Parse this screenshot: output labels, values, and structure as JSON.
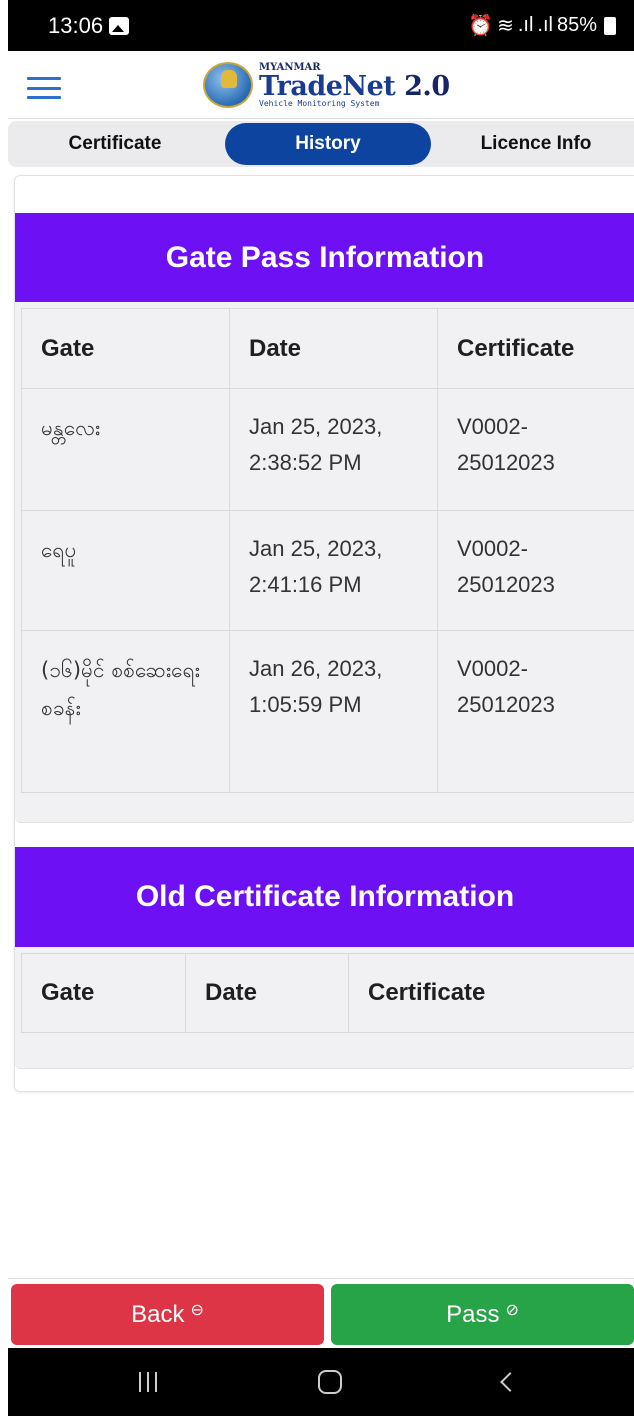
{
  "status_bar": {
    "time": "13:06",
    "right_text": "85%",
    "icons": [
      "image-icon",
      "alarm-icon",
      "wifi-icon",
      "signal-icon",
      "signal-icon",
      "battery-icon"
    ]
  },
  "header": {
    "logo_small": "MYANMAR",
    "logo_main": "TradeNet",
    "logo_version": "2.0",
    "logo_subtitle": "Vehicle Monitoring System",
    "brand_color": "#1a3c8f"
  },
  "tabs": [
    {
      "label": "Certificate",
      "active": false
    },
    {
      "label": "History",
      "active": true
    },
    {
      "label": "Licence Info",
      "active": false
    }
  ],
  "gate_pass": {
    "title": "Gate Pass Information",
    "columns": [
      "Gate",
      "Date",
      "Certificate"
    ],
    "rows": [
      {
        "gate": "မန္တလေး",
        "date_line1": "Jan 25, 2023,",
        "date_line2": "2:38:52 PM",
        "cert_line1": "V0002-",
        "cert_line2": "25012023"
      },
      {
        "gate": "ရေပူ",
        "date_line1": "Jan 25, 2023,",
        "date_line2": "2:41:16 PM",
        "cert_line1": "V0002-",
        "cert_line2": "25012023"
      },
      {
        "gate": "(၁၆)မိုင် စစ်ဆေးရေး စခန်း",
        "date_line1": "Jan 26, 2023,",
        "date_line2": "1:05:59 PM",
        "cert_line1": "V0002-",
        "cert_line2": "25012023"
      }
    ]
  },
  "old_certificate": {
    "title": "Old Certificate Information",
    "columns": [
      "Gate",
      "Date",
      "Certificate"
    ]
  },
  "buttons": {
    "back_label": "Back",
    "back_icon": "⊖",
    "pass_label": "Pass",
    "pass_icon": "⊘"
  },
  "colors": {
    "section_header": "#6d10f4",
    "active_tab": "#0d44a0",
    "back_button": "#dd3545",
    "pass_button": "#27a447"
  }
}
